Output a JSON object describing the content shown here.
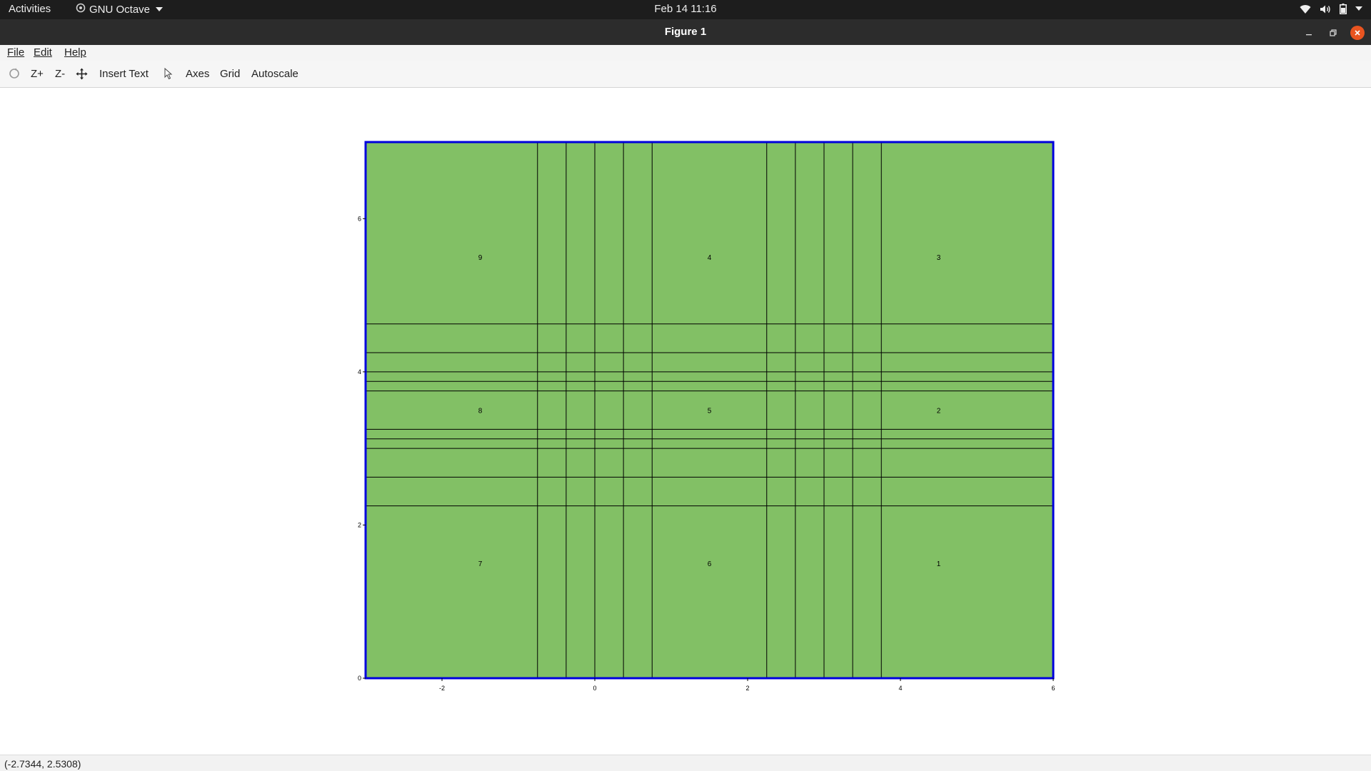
{
  "topbar": {
    "activities": "Activities",
    "app_name": "GNU Octave",
    "clock": "Feb 14  11:16",
    "tray_icons": [
      "wifi-icon",
      "volume-icon",
      "battery-icon",
      "system-menu-caret-icon"
    ]
  },
  "window": {
    "title": "Figure 1"
  },
  "menubar": {
    "file": "File",
    "edit": "Edit",
    "help": "Help"
  },
  "toolbar": {
    "rotate_icon": "rotate-icon",
    "zoom_in": "Z+",
    "zoom_out": "Z-",
    "pan_icon": "pan-icon",
    "insert_text": "Insert Text",
    "select_icon": "cursor-arrow-icon",
    "axes": "Axes",
    "grid": "Grid",
    "autoscale": "Autoscale"
  },
  "chart_data": {
    "type": "heatmap",
    "title": "",
    "xlabel": "",
    "ylabel": "",
    "xlim": [
      -3,
      6
    ],
    "ylim": [
      0,
      7
    ],
    "xticks": [
      -2,
      0,
      2,
      4,
      6
    ],
    "yticks": [
      0,
      2,
      4,
      6
    ],
    "fill_color": "#82c065",
    "edge_color": "#000000",
    "axes_color": "#0000dd",
    "vertical_lines": [
      -0.75,
      -0.375,
      0,
      0.375,
      0.75,
      2.25,
      2.625,
      3,
      3.375,
      3.75
    ],
    "horizontal_lines": [
      2.25,
      2.625,
      3,
      3.125,
      3.25,
      3.75,
      3.875,
      4,
      4.25,
      4.625
    ],
    "region_labels": [
      {
        "text": "9",
        "x": -1.5,
        "y": 5.5
      },
      {
        "text": "4",
        "x": 1.5,
        "y": 5.5
      },
      {
        "text": "3",
        "x": 4.5,
        "y": 5.5
      },
      {
        "text": "8",
        "x": -1.5,
        "y": 3.5
      },
      {
        "text": "5",
        "x": 1.5,
        "y": 3.5
      },
      {
        "text": "2",
        "x": 4.5,
        "y": 3.5
      },
      {
        "text": "7",
        "x": -1.5,
        "y": 1.5
      },
      {
        "text": "6",
        "x": 1.5,
        "y": 1.5
      },
      {
        "text": "1",
        "x": 4.5,
        "y": 1.5
      }
    ],
    "grid": false
  },
  "status": {
    "coords": "(-2.7344, 2.5308)"
  }
}
